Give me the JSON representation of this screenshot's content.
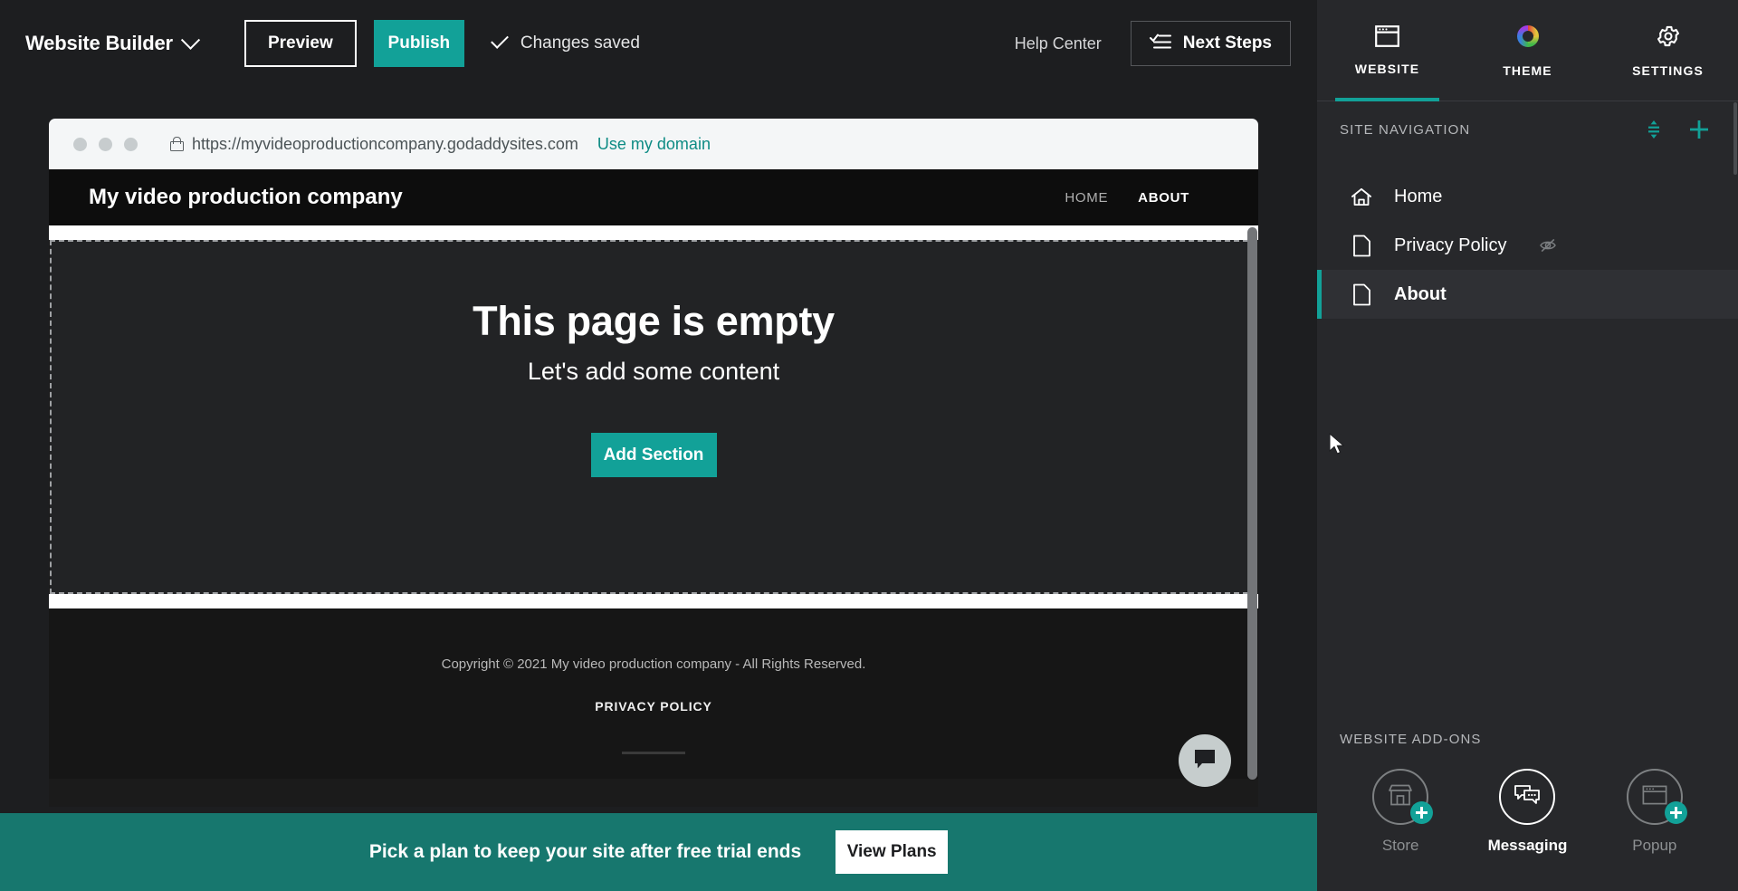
{
  "topbar": {
    "brand": "Website Builder",
    "preview_label": "Preview",
    "publish_label": "Publish",
    "saved_status": "Changes saved",
    "help_center": "Help Center",
    "next_steps": "Next Steps"
  },
  "browser": {
    "url": "https://myvideoproductioncompany.godaddysites.com",
    "use_domain_link": "Use my domain"
  },
  "site": {
    "title": "My video production company",
    "nav": [
      {
        "label": "HOME",
        "active": false
      },
      {
        "label": "ABOUT",
        "active": true
      }
    ],
    "empty_state": {
      "title": "This page is empty",
      "subtitle": "Let's add some content",
      "add_section_label": "Add Section"
    },
    "footer": {
      "copyright": "Copyright © 2021 My video production company - All Rights Reserved.",
      "privacy_link": "PRIVACY POLICY"
    }
  },
  "trial_banner": {
    "message": "Pick a plan to keep your site after free trial ends",
    "cta_label": "View Plans"
  },
  "panel": {
    "tabs": [
      {
        "label": "WEBSITE",
        "icon": "browser-window-icon",
        "active": true
      },
      {
        "label": "THEME",
        "icon": "color-wheel-icon",
        "active": false
      },
      {
        "label": "SETTINGS",
        "icon": "gear-icon",
        "active": false
      }
    ],
    "navigation": {
      "section_label": "SITE NAVIGATION",
      "reorder_tooltip": "Reorder",
      "add_tooltip": "Add",
      "items": [
        {
          "label": "Home",
          "icon": "home-icon",
          "active": false,
          "hidden": false
        },
        {
          "label": "Privacy Policy",
          "icon": "page-icon",
          "active": false,
          "hidden": true
        },
        {
          "label": "About",
          "icon": "page-icon",
          "active": true,
          "hidden": false
        }
      ]
    },
    "addons": {
      "section_label": "WEBSITE ADD-ONS",
      "items": [
        {
          "label": "Store",
          "icon": "storefront-icon",
          "enabled": false
        },
        {
          "label": "Messaging",
          "icon": "chat-bubbles-icon",
          "enabled": true
        },
        {
          "label": "Popup",
          "icon": "popup-window-icon",
          "enabled": false
        }
      ]
    }
  },
  "colors": {
    "accent_teal": "#12a198",
    "banner_teal": "#17776e",
    "panel_bg": "#27282b",
    "app_bg": "#1d1e20"
  }
}
